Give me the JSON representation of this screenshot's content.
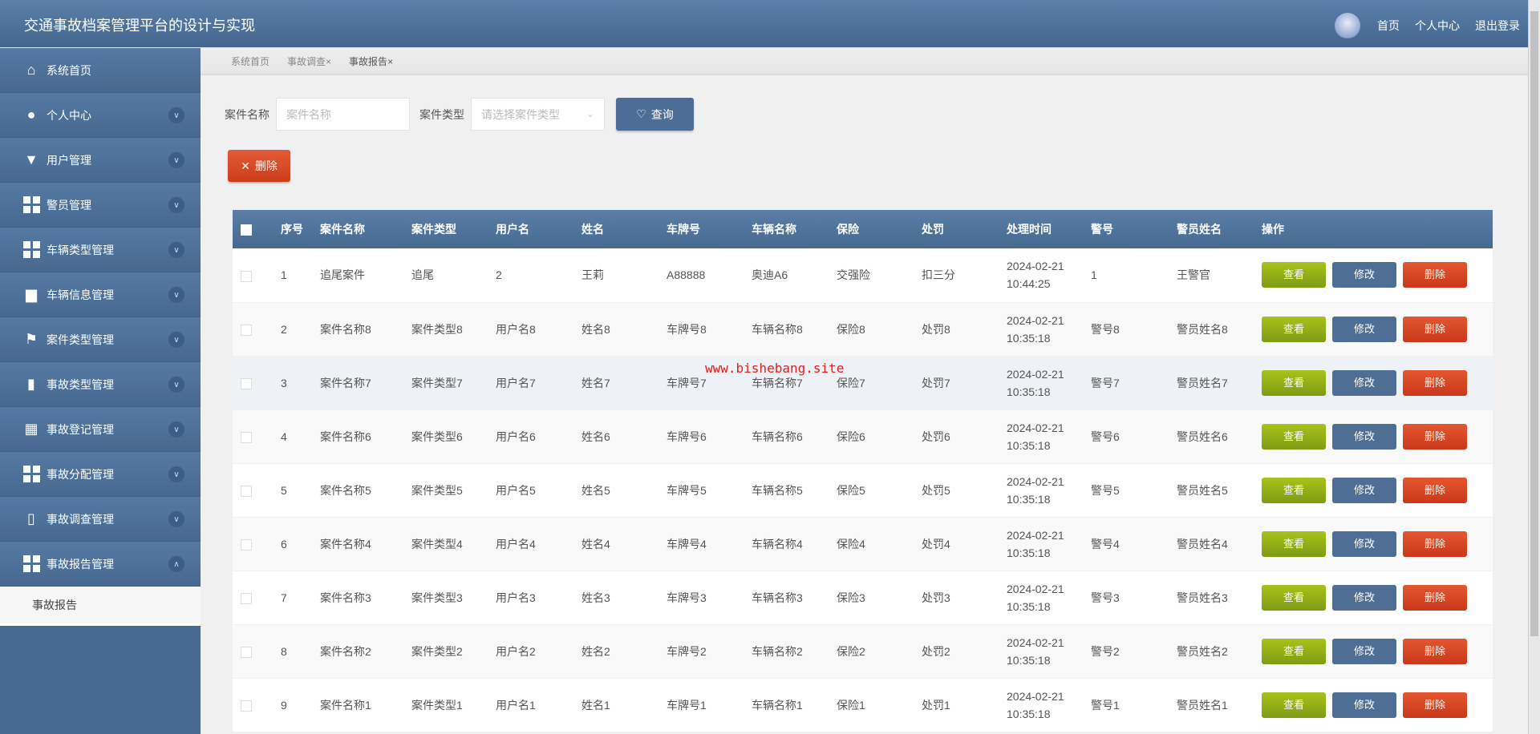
{
  "header": {
    "title": "交通事故档案管理平台的设计与实现",
    "links": [
      "首页",
      "个人中心",
      "退出登录"
    ]
  },
  "sidebar": {
    "items": [
      {
        "label": "系统首页",
        "icon": "home-icon"
      },
      {
        "label": "个人中心",
        "icon": "user-icon"
      },
      {
        "label": "用户管理",
        "icon": "brush-icon"
      },
      {
        "label": "警员管理",
        "icon": "grid-icon"
      },
      {
        "label": "车辆类型管理",
        "icon": "grid-icon"
      },
      {
        "label": "车辆信息管理",
        "icon": "briefcase-icon"
      },
      {
        "label": "案件类型管理",
        "icon": "flag-icon"
      },
      {
        "label": "事故类型管理",
        "icon": "bar-chart-icon"
      },
      {
        "label": "事故登记管理",
        "icon": "table-icon"
      },
      {
        "label": "事故分配管理",
        "icon": "grid-icon"
      },
      {
        "label": "事故调查管理",
        "icon": "clipboard-icon"
      },
      {
        "label": "事故报告管理",
        "icon": "grid-icon"
      }
    ],
    "subitem": "事故报告"
  },
  "breadcrumb": {
    "items": [
      "系统首页",
      "事故调查",
      "事故报告"
    ],
    "close": "×"
  },
  "search": {
    "name_label": "案件名称",
    "name_placeholder": "案件名称",
    "type_label": "案件类型",
    "type_placeholder": "请选择案件类型",
    "query_label": "查询"
  },
  "toolbar": {
    "delete_label": "删除"
  },
  "table": {
    "columns": [
      "序号",
      "案件名称",
      "案件类型",
      "用户名",
      "姓名",
      "车牌号",
      "车辆名称",
      "保险",
      "处罚",
      "处理时间",
      "警号",
      "警员姓名",
      "操作"
    ],
    "actions": {
      "view": "查看",
      "edit": "修改",
      "delete": "删除"
    },
    "rows": [
      [
        "1",
        "追尾案件",
        "追尾",
        "2",
        "王莉",
        "A88888",
        "奥迪A6",
        "交强险",
        "扣三分",
        "2024-02-21",
        "10:44:25",
        "1",
        "王警官"
      ],
      [
        "2",
        "案件名称8",
        "案件类型8",
        "用户名8",
        "姓名8",
        "车牌号8",
        "车辆名称8",
        "保险8",
        "处罚8",
        "2024-02-21",
        "10:35:18",
        "警号8",
        "警员姓名8"
      ],
      [
        "3",
        "案件名称7",
        "案件类型7",
        "用户名7",
        "姓名7",
        "车牌号7",
        "车辆名称7",
        "保险7",
        "处罚7",
        "2024-02-21",
        "10:35:18",
        "警号7",
        "警员姓名7"
      ],
      [
        "4",
        "案件名称6",
        "案件类型6",
        "用户名6",
        "姓名6",
        "车牌号6",
        "车辆名称6",
        "保险6",
        "处罚6",
        "2024-02-21",
        "10:35:18",
        "警号6",
        "警员姓名6"
      ],
      [
        "5",
        "案件名称5",
        "案件类型5",
        "用户名5",
        "姓名5",
        "车牌号5",
        "车辆名称5",
        "保险5",
        "处罚5",
        "2024-02-21",
        "10:35:18",
        "警号5",
        "警员姓名5"
      ],
      [
        "6",
        "案件名称4",
        "案件类型4",
        "用户名4",
        "姓名4",
        "车牌号4",
        "车辆名称4",
        "保险4",
        "处罚4",
        "2024-02-21",
        "10:35:18",
        "警号4",
        "警员姓名4"
      ],
      [
        "7",
        "案件名称3",
        "案件类型3",
        "用户名3",
        "姓名3",
        "车牌号3",
        "车辆名称3",
        "保险3",
        "处罚3",
        "2024-02-21",
        "10:35:18",
        "警号3",
        "警员姓名3"
      ],
      [
        "8",
        "案件名称2",
        "案件类型2",
        "用户名2",
        "姓名2",
        "车牌号2",
        "车辆名称2",
        "保险2",
        "处罚2",
        "2024-02-21",
        "10:35:18",
        "警号2",
        "警员姓名2"
      ],
      [
        "9",
        "案件名称1",
        "案件类型1",
        "用户名1",
        "姓名1",
        "车牌号1",
        "车辆名称1",
        "保险1",
        "处罚1",
        "2024-02-21",
        "10:35:18",
        "警号1",
        "警员姓名1"
      ]
    ]
  },
  "watermark": "www.bishebang.site"
}
